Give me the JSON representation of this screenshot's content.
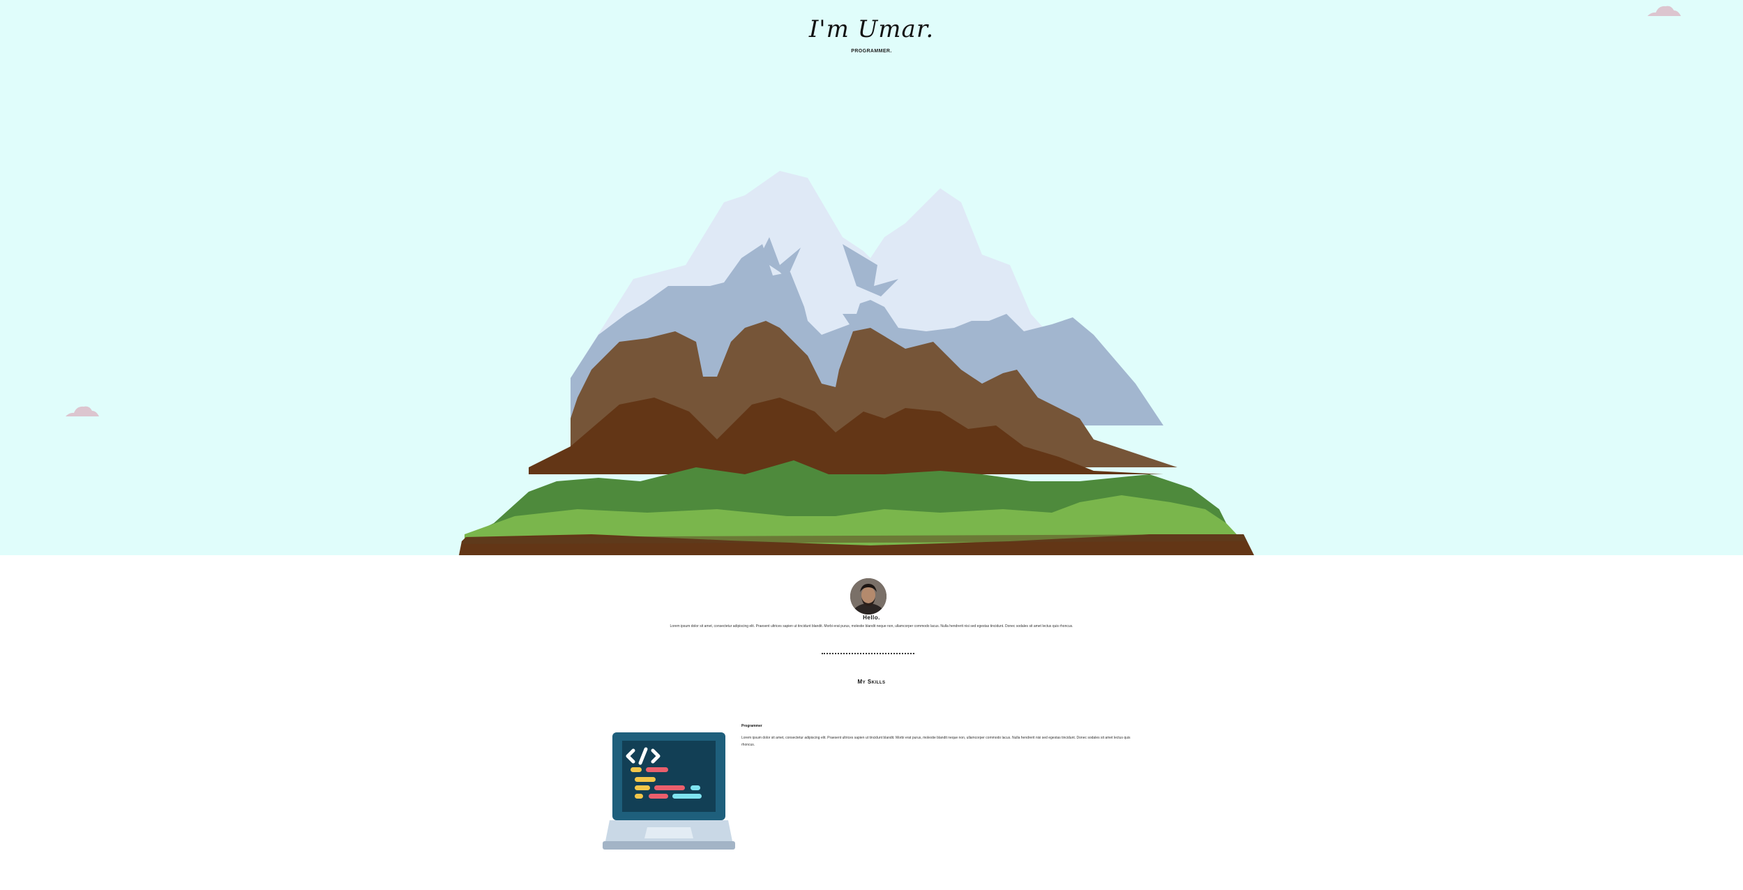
{
  "hero": {
    "title": "I'm Umar.",
    "subtitle": "PROGRAMMER."
  },
  "about": {
    "greeting": "Hello.",
    "text": "Lorem ipsum dolor sit amet, consectetur adipiscing elit. Praesent ultrices sapien ut tincidunt blandit. Morbi erat purus, molestie blandit neque non, ullamcorper commodo lacus. Nulla hendrerit nisi sed egestas tincidunt. Donec sodales sit amet lectus quis rhoncus."
  },
  "skills": {
    "title": "My Skills",
    "items": [
      {
        "name": "Programmer",
        "description": "Lorem ipsum dolor sit amet, consectetur adipiscing elit. Praesent ultrices sapien ut tincidunt blandit. Morbi erat purus, molestie blandit neque non, ullamcorper commodo lacus. Nulla hendrerit nisi sed egestas tincidunt. Donec sodales sit amet lectus quis rhoncus.",
        "icon": "laptop-code-icon"
      }
    ]
  },
  "colors": {
    "sky": "#e0fdfb",
    "snow": "#dfe9f6",
    "rock_shadow": "#a2b6cf",
    "rock_light": "#765538",
    "rock_dark": "#633616",
    "grass_dark": "#4e8a3c",
    "grass_light": "#7ab64c",
    "cloud": "#dcc5cf"
  }
}
